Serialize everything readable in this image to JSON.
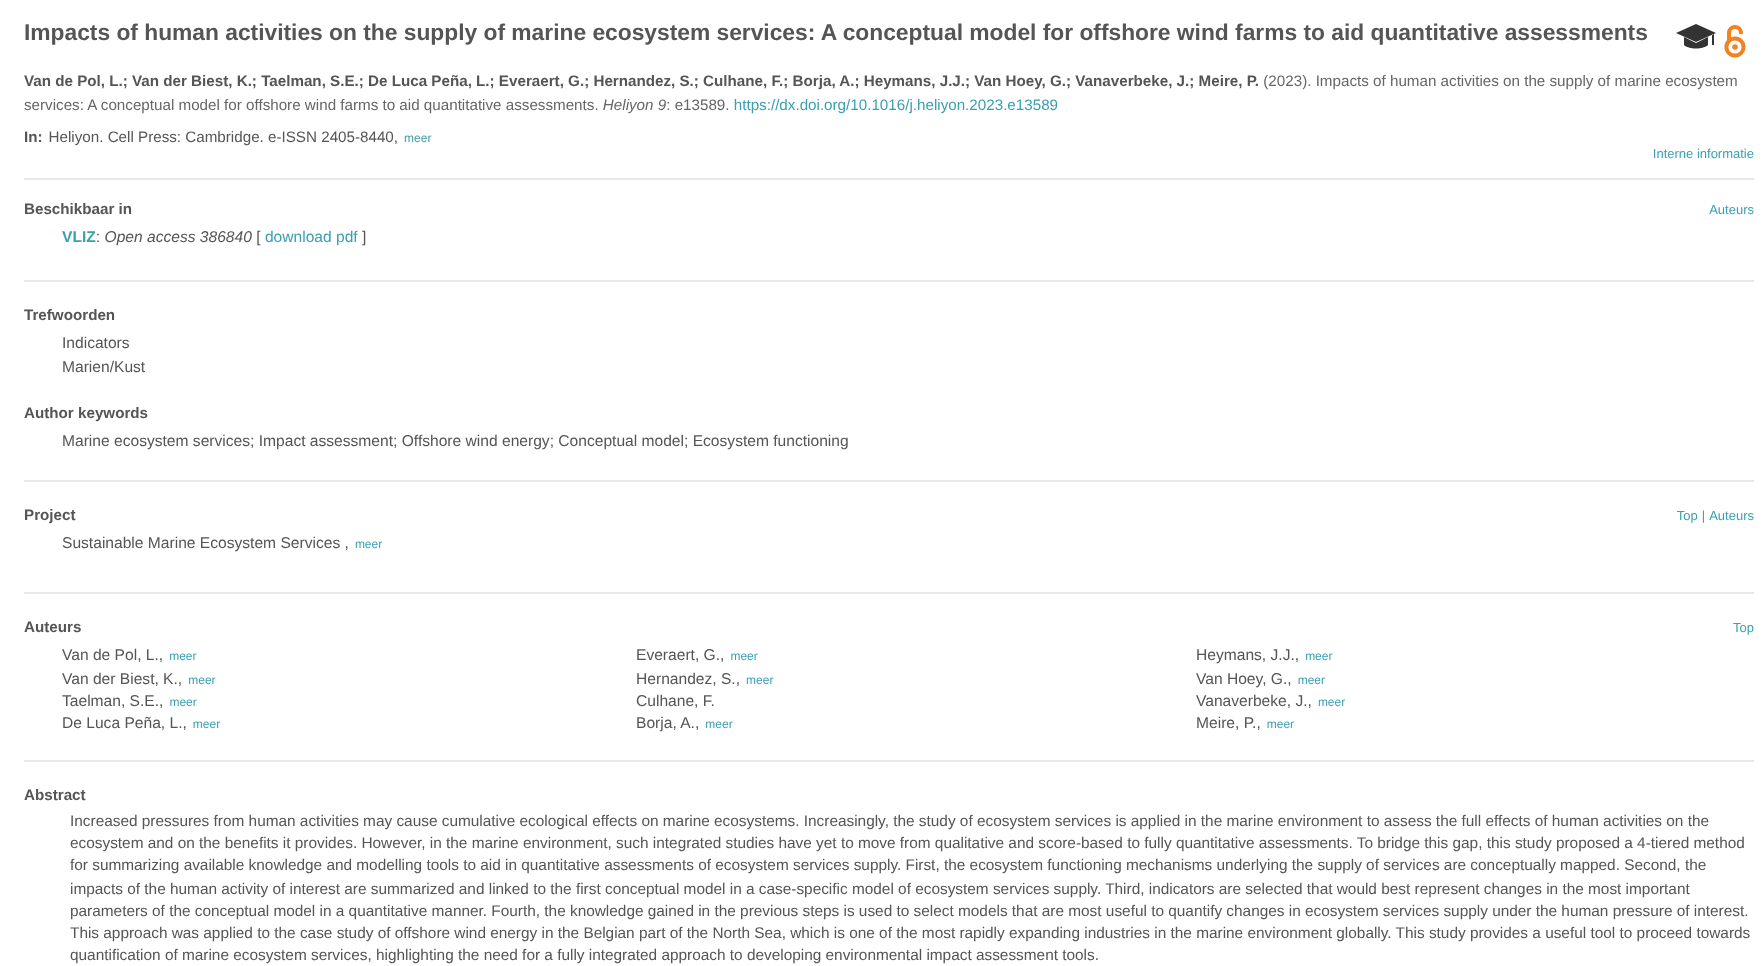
{
  "title": "Impacts of human activities on the supply of marine ecosystem services: A conceptual model for offshore wind farms to aid quantitative assessments",
  "citation": {
    "text": "**Van de Pol, L.; Van der Biest, K.; Taelman, S.E.; De Luca Peña, L.; Everaert, G.; Hernandez, S.; Culhane, F.; Borja, A.; Heymans, J.J.; Van Hoey, G.; Vanaverbeke, J.; Meire, P.** (2023). Impacts of human activities on the supply of marine ecosystem services: A conceptual model for offshore wind farms to aid quantitative assessments. *Heliyon 9*: e13589.",
    "doi": "https://dx.doi.org/10.1016/j.heliyon.2023.e13589"
  },
  "source": {
    "label": "In:",
    "text": "Heliyon. Cell Press: Cambridge. e-ISSN 2405-8440,",
    "more": "meer"
  },
  "internal_link": "Interne informatie",
  "groups": [
    {
      "nav": {
        "links": [
          "Auteurs"
        ]
      },
      "blocks": [
        {
          "kind": "availability",
          "heading": "Beschikbaar in",
          "org": "VLIZ",
          "separator": ":",
          "note": "Open access 386840",
          "open": "[",
          "link": "download pdf",
          "close": "]"
        }
      ]
    },
    {
      "blocks": [
        {
          "kind": "list",
          "heading": "Trefwoorden",
          "items": [
            "Indicators",
            "Marien/Kust"
          ]
        },
        {
          "kind": "text",
          "heading": "Author keywords",
          "text": "Marine ecosystem services; Impact assessment; Offshore wind energy; Conceptual model; Ecosystem functioning"
        }
      ]
    },
    {
      "nav": {
        "links": [
          "Top",
          "Auteurs"
        ],
        "separator": "|"
      },
      "blocks": [
        {
          "kind": "project",
          "heading": "Project",
          "text": "Sustainable Marine Ecosystem Services ,",
          "more": "meer"
        }
      ]
    },
    {
      "nav": {
        "links": [
          "Top"
        ]
      },
      "blocks": [
        {
          "kind": "authors",
          "heading": "Auteurs",
          "authors": [
            {
              "name": "Van de Pol, L.,",
              "more": "meer"
            },
            {
              "name": "Van der Biest, K.,",
              "more": "meer"
            },
            {
              "name": "Taelman, S.E.,",
              "more": "meer"
            },
            {
              "name": "De Luca Peña, L.,",
              "more": "meer"
            },
            {
              "name": "Everaert, G.,",
              "more": "meer"
            },
            {
              "name": "Hernandez, S.,",
              "more": "meer"
            },
            {
              "name": "Culhane, F."
            },
            {
              "name": "Borja, A.,",
              "more": "meer"
            },
            {
              "name": "Heymans, J.J.,",
              "more": "meer"
            },
            {
              "name": "Van Hoey, G.,",
              "more": "meer"
            },
            {
              "name": "Vanaverbeke, J.,",
              "more": "meer"
            },
            {
              "name": "Meire, P.,",
              "more": "meer"
            }
          ]
        }
      ]
    },
    {
      "blocks": [
        {
          "kind": "abstract",
          "heading": "Abstract",
          "text": "Increased pressures from human activities may cause cumulative ecological effects on marine ecosystems. Increasingly, the study of ecosystem services is applied in the marine environment to assess the full effects of human activities on the ecosystem and on the benefits it provides. However, in the marine environment, such integrated studies have yet to move from qualitative and score-based to fully quantitative assessments. To bridge this gap, this study proposed a 4-tiered method for summarizing available knowledge and modelling tools to aid in quantitative assessments of ecosystem services supply. First, the ecosystem functioning mechanisms underlying the supply of services are conceptually mapped. Second, the impacts of the human activity of interest are summarized and linked to the first conceptual model in a case-specific model of ecosystem services supply. Third, indicators are selected that would best represent changes in the most important parameters of the conceptual model in a quantitative manner. Fourth, the knowledge gained in the previous steps is used to select models that are most useful to quantify changes in ecosystem services supply under the human pressure of interest. This approach was applied to the case study of offshore wind energy in the Belgian part of the North Sea, which is one of the most rapidly expanding industries in the marine environment globally. This study provides a useful tool to proceed towards quantification of marine ecosystem services, highlighting the need for a fully integrated approach to developing environmental impact assessment tools."
        }
      ]
    }
  ]
}
